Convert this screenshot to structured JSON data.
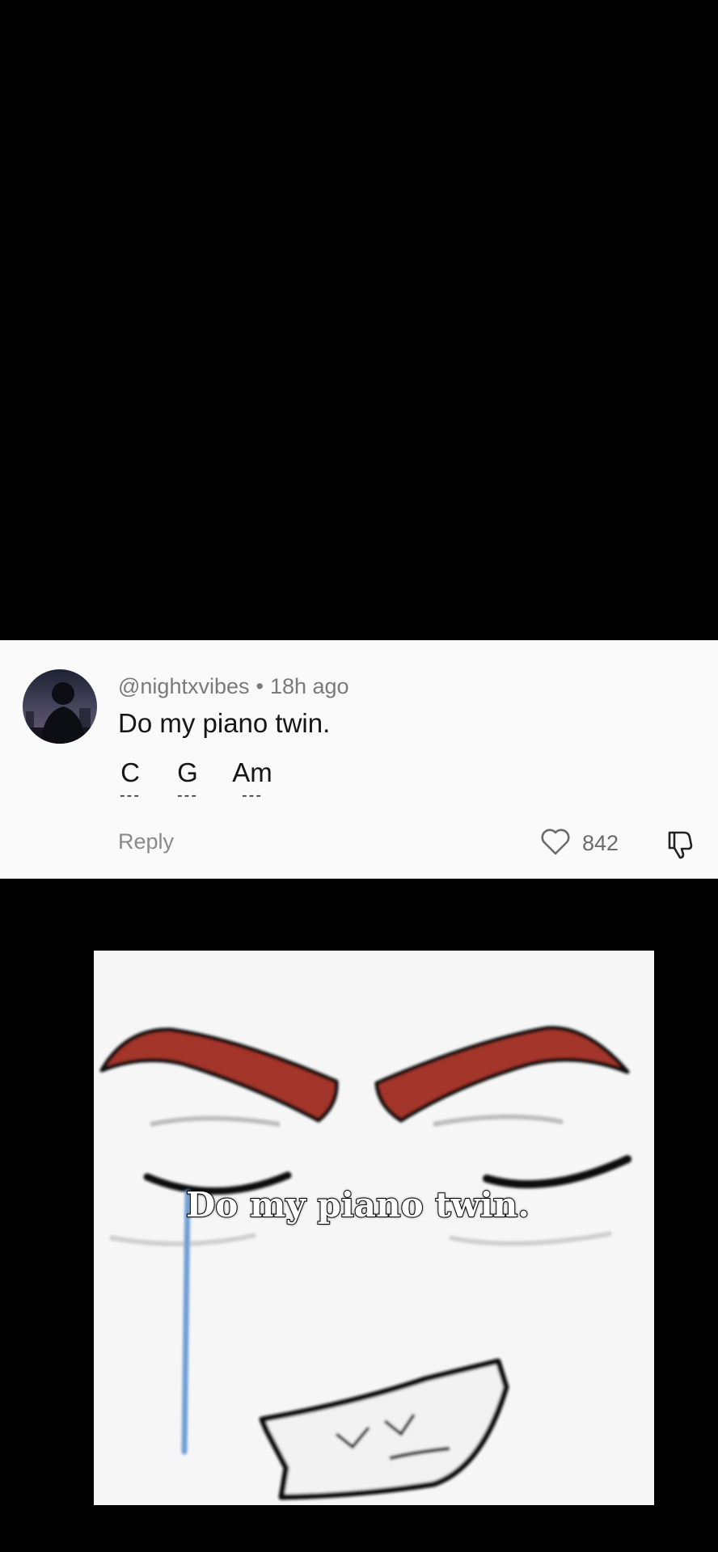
{
  "comment": {
    "username": "@nightxvibes",
    "separator": "•",
    "time": "18h ago",
    "text": "Do my piano twin.",
    "chords": [
      {
        "name": "C",
        "dashes": "---"
      },
      {
        "name": "G",
        "dashes": "---"
      },
      {
        "name": "Am",
        "dashes": "---"
      }
    ],
    "reply_label": "Reply",
    "like_count": "842",
    "icons": {
      "like": "heart-icon",
      "dislike": "thumbs-down-icon"
    }
  },
  "meme": {
    "caption": "Do my piano twin.",
    "colors": {
      "eyebrow": "#a3362c",
      "tear": "#6f9fd4",
      "outline": "#111111"
    }
  }
}
